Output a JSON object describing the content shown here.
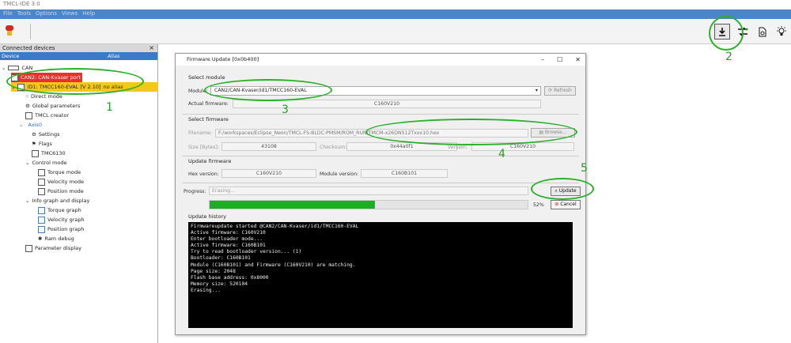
{
  "window": {
    "title": "TMCL-IDE 3.0",
    "menu": [
      "File",
      "Tools",
      "Options",
      "Views",
      "Help"
    ]
  },
  "toolbar": {
    "icons": [
      "stop-icon",
      "download-icon",
      "swap-icon",
      "document-search-icon",
      "lightbulb-icon"
    ]
  },
  "devices_panel": {
    "title": "Connected devices",
    "col_device": "Device",
    "col_alias": "Alias",
    "items": [
      {
        "label": "CAN",
        "icon": "can-icon"
      },
      {
        "label": "CAN2: CAN-Kvaser port",
        "icon": "port-icon"
      },
      {
        "label": "ID1: TMCC160-EVAL [V 2.10]",
        "alias": "no alias",
        "icon": "module-icon"
      },
      {
        "label": "Direct mode",
        "icon": "hand-icon"
      },
      {
        "label": "Global parameters",
        "icon": "gear-icon"
      },
      {
        "label": "TMCL creator",
        "icon": "document-icon"
      },
      {
        "label": "Axis0",
        "icon": "axis-icon"
      },
      {
        "label": "Settings",
        "icon": "gear-icon"
      },
      {
        "label": "Flags",
        "icon": "flag-icon"
      },
      {
        "label": "TMC6130",
        "icon": "chip-icon"
      },
      {
        "label": "Control mode",
        "icon": "folder-icon"
      },
      {
        "label": "Torque mode",
        "icon": "grid-icon"
      },
      {
        "label": "Velocity mode",
        "icon": "grid-icon"
      },
      {
        "label": "Position mode",
        "icon": "grid-icon"
      },
      {
        "label": "Info graph and display",
        "icon": "folder-icon"
      },
      {
        "label": "Torque graph",
        "icon": "graph-icon"
      },
      {
        "label": "Velocity graph",
        "icon": "graph-icon"
      },
      {
        "label": "Position graph",
        "icon": "graph-icon"
      },
      {
        "label": "Ram debug",
        "icon": "bug-icon"
      },
      {
        "label": "Parameter display",
        "icon": "table-icon"
      }
    ]
  },
  "annotations": [
    "1",
    "2",
    "3",
    "4",
    "5"
  ],
  "dialog": {
    "title": "Firmware Update [0x0b400]",
    "controls": [
      "–",
      "☐",
      "✕"
    ],
    "select_module": {
      "heading": "Select module",
      "module_label": "Module:",
      "module_value": "CAN2/CAN-Kvaser/id1/TMCC160-EVAL",
      "refresh_label": "Refresh",
      "actual_fw_label": "Actual firmware:",
      "actual_fw_value": "C160V210"
    },
    "select_firmware": {
      "heading": "Select firmware",
      "filename_label": "Filename:",
      "filename_value": "F:/workspaces/Eclipse_Neon/TMCL-FS-BLDC-PMSM/ROM_RUN/TMCM-x26DN512Txxx10.hex",
      "browse_label": "Browse...",
      "size_label": "Size [Bytes]:",
      "size_value": "43108",
      "checksum_label": "Checksum:",
      "checksum_value": "0x44a0f1",
      "version_label": "Version:",
      "version_value": "C160V210"
    },
    "update_firmware": {
      "heading": "Update firmware",
      "hex_version_label": "Hex version:",
      "hex_version_value": "C160V210",
      "module_version_label": "Module version:",
      "module_version_value": "C160B101"
    },
    "progress": {
      "label": "Progress:",
      "status": "Erasing...",
      "percent_text": "52%",
      "fraction": 0.52,
      "update_label": "Update",
      "cancel_label": "Cancel"
    },
    "history": {
      "heading": "Update history",
      "log": "Firmwareupdate started @CAN2/CAN-Kvaser/id1/TMCC160-EVAL\nActive firmware: C160V210\nEnter bootloader mode...\nActive firmware: C160B101\nTry to read bootloader version... (1)\nBootloader: C160B101\nModule (C160B101) and Firmware (C160V210) are matching.\nPage size: 2048\nFlash base address: 0x8000\nMemory size: 520104\nErasing..."
    }
  }
}
